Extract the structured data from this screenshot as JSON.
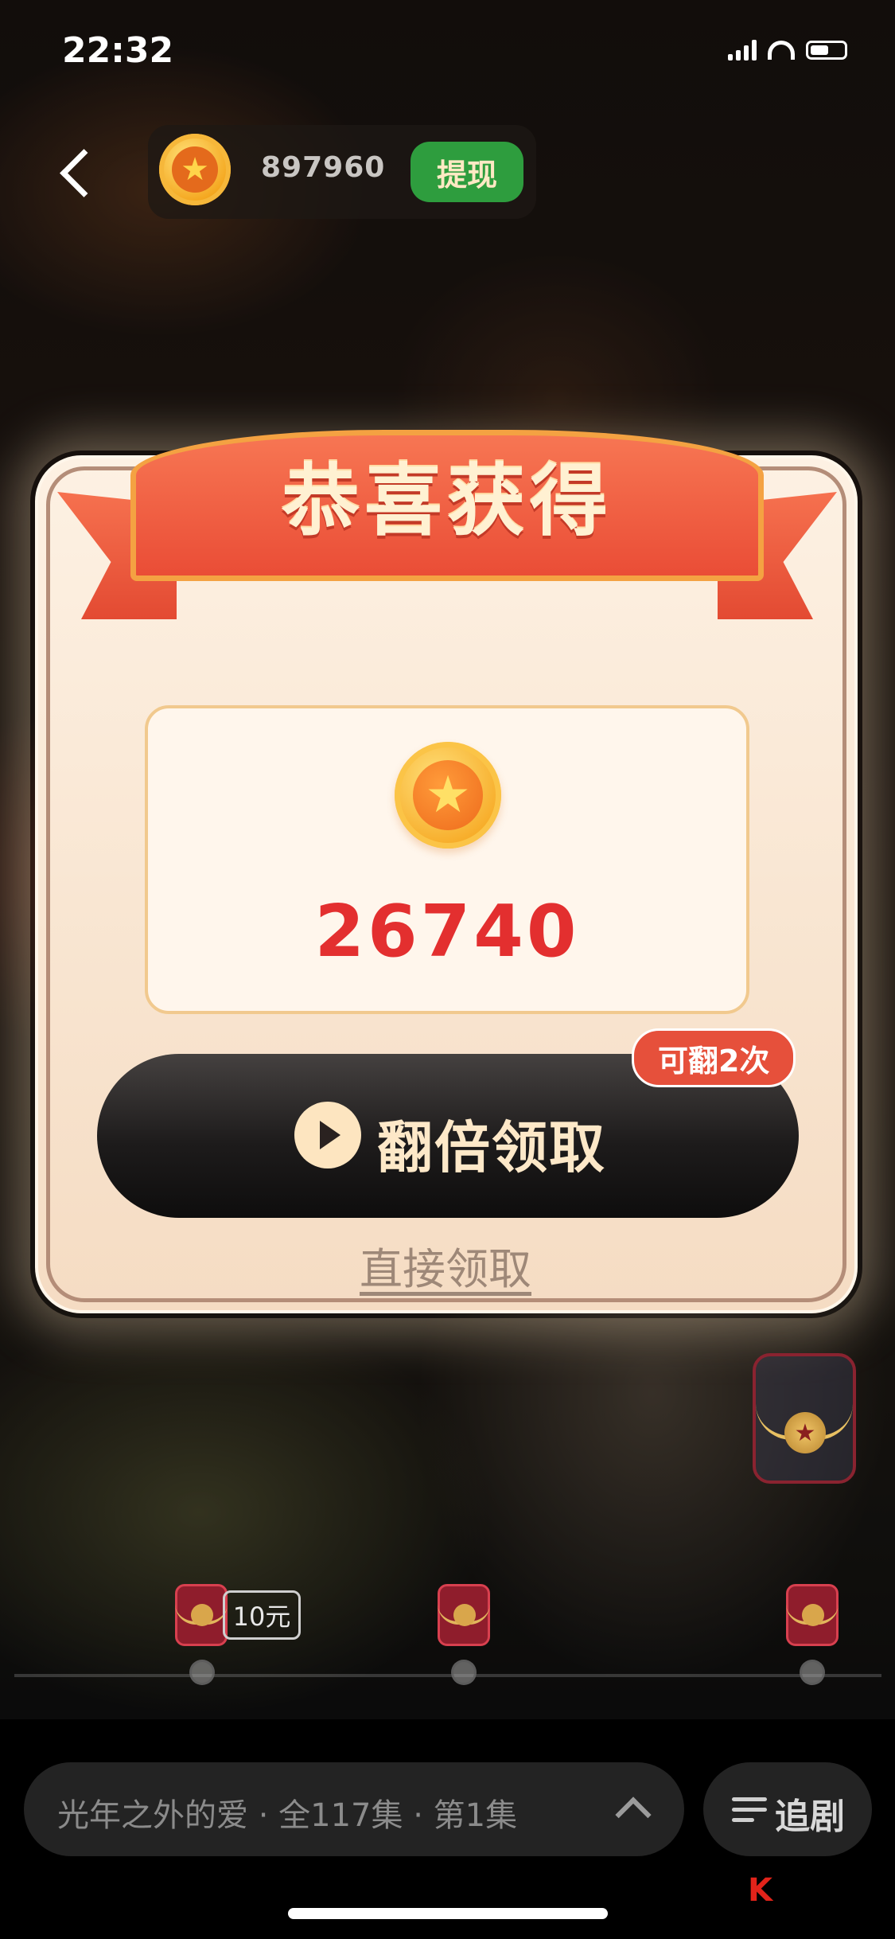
{
  "status_bar": {
    "time": "22:32"
  },
  "header": {
    "balance": "897960",
    "withdraw_label": "提现"
  },
  "modal": {
    "title": "恭喜获得",
    "reward_amount": "26740",
    "double_button_label": "翻倍领取",
    "flip_badge": "可翻2次",
    "direct_claim_label": "直接领取"
  },
  "progress": {
    "amount_tag": "10元"
  },
  "bottom_bar": {
    "series_title": "光年之外的爱 · 全117集 · 第1集",
    "follow_label": "追剧"
  },
  "icons": {
    "back": "chevron-left-icon",
    "coin": "star-coin-icon",
    "play": "play-icon",
    "expand": "chevron-up-icon",
    "follow": "playlist-add-icon",
    "envelope": "red-envelope-icon"
  },
  "colors": {
    "reward_red": "#e32f2f",
    "withdraw_green": "#2e9d3e",
    "ribbon_red": "#ea4d36",
    "badge_red": "#e6503b"
  }
}
